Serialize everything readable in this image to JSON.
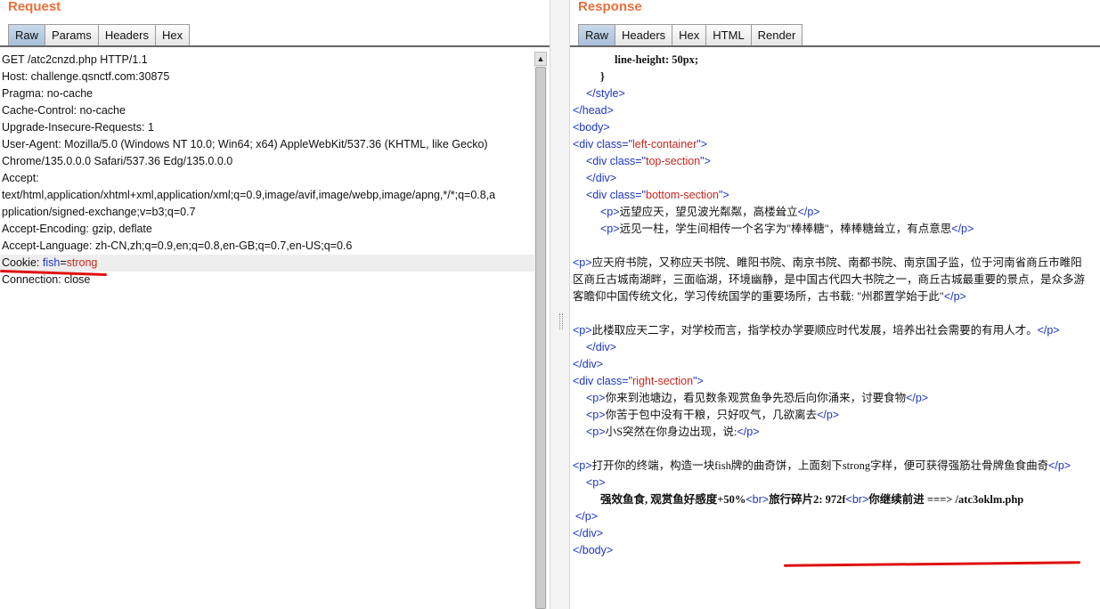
{
  "request": {
    "title": "Request",
    "tabs": [
      "Raw",
      "Params",
      "Headers",
      "Hex"
    ],
    "lines": {
      "l1": "GET /atc2cnzd.php HTTP/1.1",
      "l2": "Host: challenge.qsnctf.com:30875",
      "l3": "Pragma: no-cache",
      "l4": "Cache-Control: no-cache",
      "l5": "Upgrade-Insecure-Requests: 1",
      "l6": "User-Agent: Mozilla/5.0 (Windows NT 10.0; Win64; x64) AppleWebKit/537.36 (KHTML, like Gecko)",
      "l7": "Chrome/135.0.0.0 Safari/537.36 Edg/135.0.0.0",
      "l8": "Accept:",
      "l9": "text/html,application/xhtml+xml,application/xml;q=0.9,image/avif,image/webp,image/apng,*/*;q=0.8,a",
      "l10": "pplication/signed-exchange;v=b3;q=0.7",
      "l11": "Accept-Encoding: gzip, deflate",
      "l12": "Accept-Language: zh-CN,zh;q=0.9,en;q=0.8,en-GB;q=0.7,en-US;q=0.6",
      "cookie_key": "Cookie: ",
      "cookie_name": "fish",
      "cookie_eq": "=",
      "cookie_value": "strong",
      "l14": "Connection: close"
    }
  },
  "response": {
    "title": "Response",
    "tabs": [
      "Raw",
      "Headers",
      "Hex",
      "HTML",
      "Render"
    ],
    "t": {
      "lh": "line-height: 50px;",
      "brace": "}",
      "style_close": "</style>",
      "head_close": "</head>",
      "body_open": "<body>",
      "div_open": "<div ",
      "class_attr": "class",
      "eq_q": "=\"",
      "q_gt": "\">",
      "left_container": "left-container",
      "top_section": "top-section",
      "bottom_section": "bottom-section",
      "right_section": "right-section",
      "div_close": "</div>",
      "p_open": "<p>",
      "p_close": "</p>",
      "br": "<br>",
      "body_close": "</body>",
      "p1": "远望应天，望见波光粼粼，高楼耸立",
      "p2": "远见一柱，学生间相传一个名字为\"棒棒糖\"，棒棒糖耸立，有点意思",
      "p3": "应天府书院，又称应天书院、睢阳书院、南京书院、南都书院、南京国子监，位于河南省商丘市睢阳区商丘古城南湖畔，三面临湖，环境幽静，是中国古代四大书院之一，商丘古城最重要的景点，是众多游客瞻仰中国传统文化，学习传统国学的重要场所，古书载: \"州郡置学始于此\"",
      "p4": "此楼取应天二字，对学校而言，指学校办学要顺应时代发展，培养出社会需要的有用人才。",
      "p5": "你来到池塘边，看见数条观赏鱼争先恐后向你涌来，讨要食物",
      "p6": "你苦于包中没有干粮，只好叹气，几欲离去",
      "p7": "小S突然在你身边出现，说:",
      "p8": "打开你的终端，构造一块fish牌的曲奇饼，上面刻下strong字样，便可获得强筋壮骨牌鱼食曲奇",
      "p9a": "强效鱼食, 观赏鱼好感度+50%",
      "p9b": "旅行碎片2: 972f",
      "p9c": "你继续前进 ===> /atc3oklm.php"
    }
  }
}
